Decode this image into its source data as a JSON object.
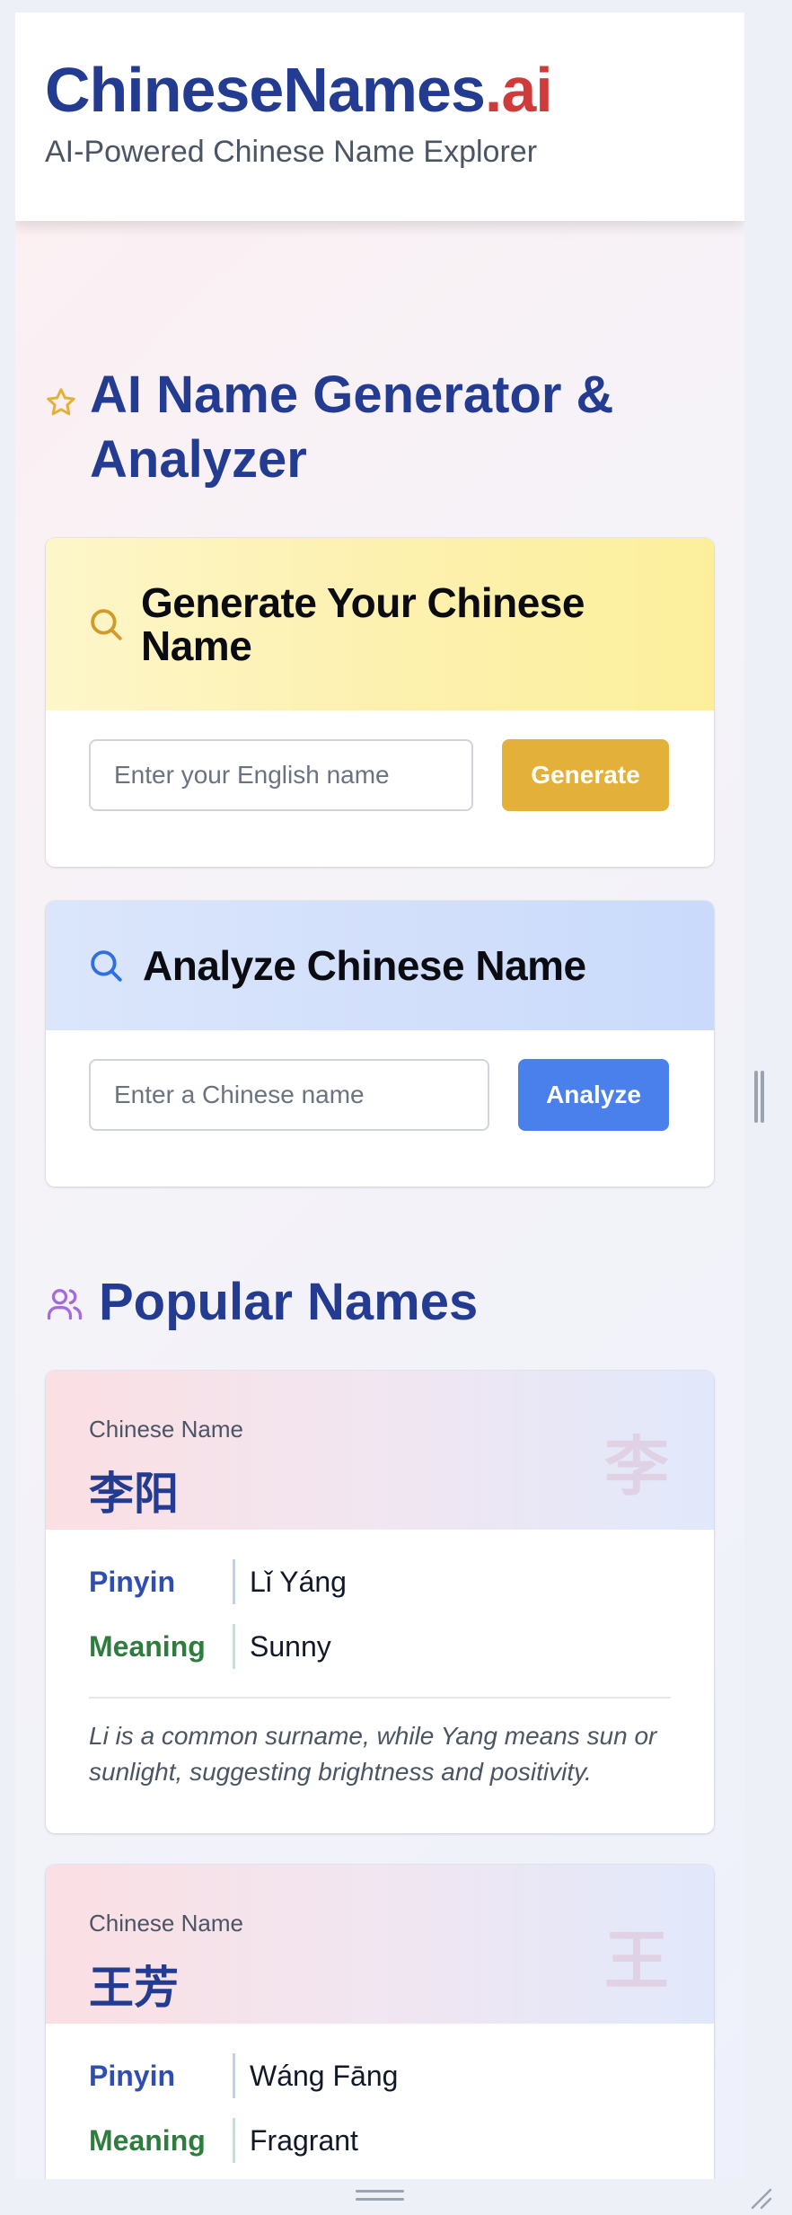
{
  "header": {
    "brand_main": "ChineseNames",
    "brand_accent": ".ai",
    "tagline": "AI-Powered Chinese Name Explorer"
  },
  "generator_section": {
    "title": "AI Name Generator & Analyzer",
    "icon": "star-icon"
  },
  "generate_card": {
    "title": "Generate Your Chinese Name",
    "icon": "search-icon",
    "input_placeholder": "Enter your English name",
    "button_label": "Generate",
    "accent": "#e3b13a"
  },
  "analyze_card": {
    "title": "Analyze Chinese Name",
    "icon": "search-icon",
    "input_placeholder": "Enter a Chinese name",
    "button_label": "Analyze",
    "accent": "#4a80ec"
  },
  "popular_section": {
    "title": "Popular Names",
    "icon": "users-icon"
  },
  "names": [
    {
      "label": "Chinese Name",
      "chinese": "李阳",
      "watermark": "李",
      "pinyin_label": "Pinyin",
      "pinyin": "Lǐ Yáng",
      "meaning_label": "Meaning",
      "meaning": "Sunny",
      "description": "Li is a common surname, while Yang means sun or sunlight, suggesting brightness and positivity."
    },
    {
      "label": "Chinese Name",
      "chinese": "王芳",
      "watermark": "王",
      "pinyin_label": "Pinyin",
      "pinyin": "Wáng Fāng",
      "meaning_label": "Meaning",
      "meaning": "Fragrant"
    }
  ],
  "colors": {
    "brand_blue": "#233b91",
    "brand_red": "#cf3b3b",
    "pinyin": "#2f4db3",
    "meaning": "#2f7d3e"
  }
}
